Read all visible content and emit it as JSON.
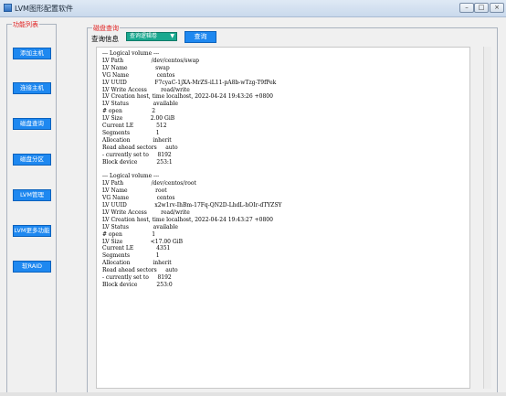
{
  "window": {
    "title": "LVM图形配置软件",
    "controls": [
      "–",
      "□",
      "×"
    ]
  },
  "sidebar": {
    "title": "功能列表",
    "items": [
      {
        "label": "添加主机"
      },
      {
        "label": "连接主机"
      },
      {
        "label": "磁盘查询"
      },
      {
        "label": "磁盘分区"
      },
      {
        "label": "LVM管理"
      },
      {
        "label": "LVM更多功能"
      },
      {
        "label": "软RAID"
      }
    ]
  },
  "query": {
    "group_title": "磁盘查询",
    "label": "查询信息",
    "select_value": "查询逻辑卷",
    "button_label": "查询"
  },
  "output": {
    "lines": [
      "--- Logical volume ---",
      "LV Path                /dev/centos/swap",
      "LV Name                swap",
      "VG Name                centos",
      "LV UUID                F7cyaC-1jXA-MrZS-iL11-pA8b-wTzg-T9fPek",
      "LV Write Access        read/write",
      "LV Creation host, time localhost, 2022-04-24 19:43:26 +0800",
      "LV Status              available",
      "# open                 2",
      "LV Size                2.00 GiB",
      "Current LE             512",
      "Segments               1",
      "Allocation             inherit",
      "Read ahead sectors     auto",
      "- currently set to     8192",
      "Block device           253:1",
      "",
      "--- Logical volume ---",
      "LV Path                /dev/centos/root",
      "LV Name                root",
      "VG Name                centos",
      "LV UUID                x2w1rv-IhBm-17Fq-QN2D-LhdL-hOIr-dTYZSY",
      "LV Write Access        read/write",
      "LV Creation host, time localhost, 2022-04-24 19:43:27 +0800",
      "LV Status              available",
      "# open                 1",
      "LV Size                <17.00 GiB",
      "Current LE             4351",
      "Segments               1",
      "Allocation             inherit",
      "Read ahead sectors     auto",
      "- currently set to     8192",
      "Block device           253:0"
    ]
  }
}
